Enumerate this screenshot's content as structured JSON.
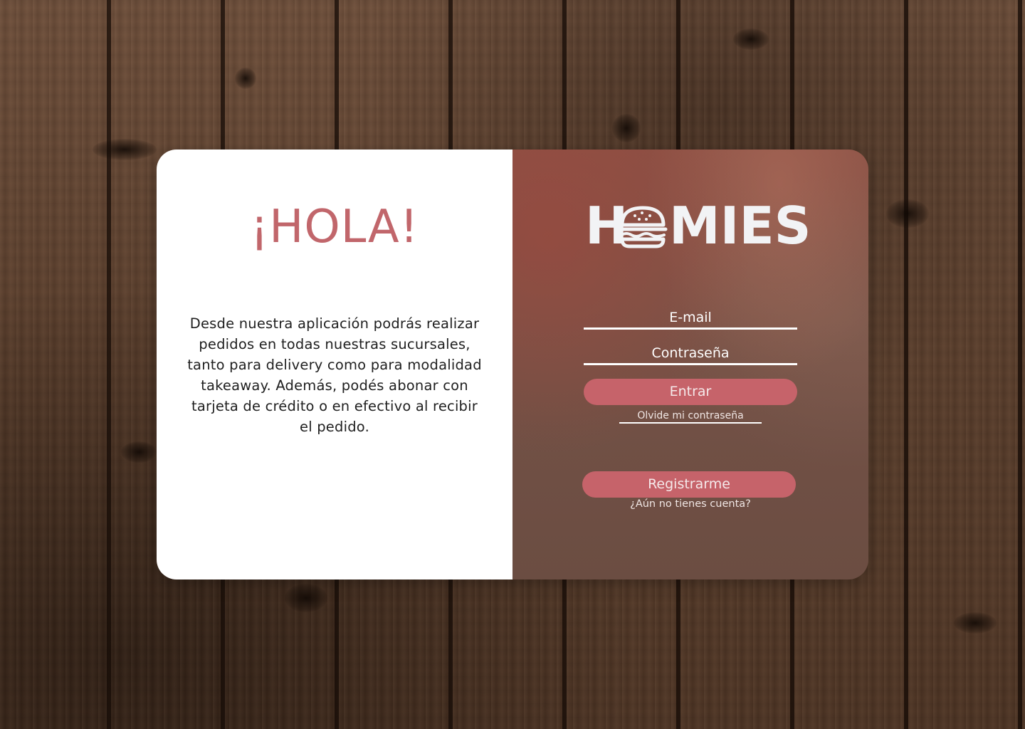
{
  "greeting": "¡HOLA!",
  "description": "Desde nuestra aplicación podrás realizar pedidos en todas nuestras sucursales, tanto para delivery como para modalidad takeaway. Además, podés abonar con tarjeta de crédito o en efectivo al recibir el pedido.",
  "logo": {
    "letter_before": "H",
    "letters_after": "MIES",
    "icon": "burger-icon"
  },
  "form": {
    "email_label": "E-mail",
    "password_label": "Contraseña",
    "login_button": "Entrar",
    "forgot_link": "Olvide mi contraseña",
    "register_button": "Registrarme",
    "no_account_text": "¿Aún no tienes cuenta?"
  },
  "colors": {
    "accent": "#c6636a",
    "greeting": "#c1666b",
    "panel_left": "#ffffff",
    "panel_right": "#7d5347"
  }
}
